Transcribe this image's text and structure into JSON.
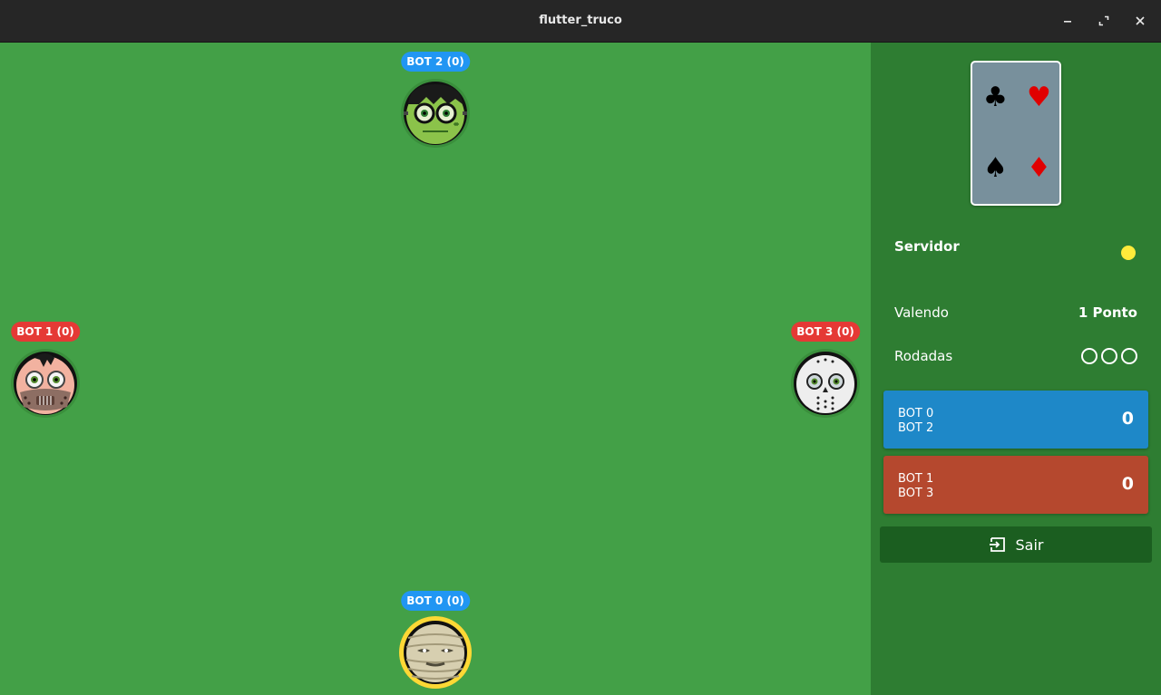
{
  "window": {
    "title": "flutter_truco"
  },
  "players": {
    "bot2": {
      "label": "BOT 2 (0)",
      "team_color": "#2196f3",
      "avatar": "frankenstein-avatar"
    },
    "bot1": {
      "label": "BOT 1 (0)",
      "team_color": "#e53935",
      "avatar": "hannibal-avatar"
    },
    "bot3": {
      "label": "BOT 3 (0)",
      "team_color": "#e53935",
      "avatar": "jason-avatar"
    },
    "bot0": {
      "label": "BOT 0 (0)",
      "team_color": "#2196f3",
      "avatar": "mummy-avatar",
      "is_current": true
    }
  },
  "deck": {
    "suits": [
      "♣",
      "♥",
      "♠",
      "♦"
    ]
  },
  "info": {
    "server_label": "Servidor",
    "server_color": "#ffeb3b",
    "value_label": "Valendo",
    "value": "1 Ponto",
    "rounds_label": "Rodadas",
    "rounds": [
      "empty",
      "empty",
      "empty"
    ]
  },
  "teams": [
    {
      "members": [
        "BOT 0",
        "BOT 2"
      ],
      "score": "0",
      "color": "#1e88c8"
    },
    {
      "members": [
        "BOT 1",
        "BOT 3"
      ],
      "score": "0",
      "color": "#b5482e"
    }
  ],
  "exit": {
    "label": "Sair",
    "icon": "exit-to-app-icon"
  }
}
